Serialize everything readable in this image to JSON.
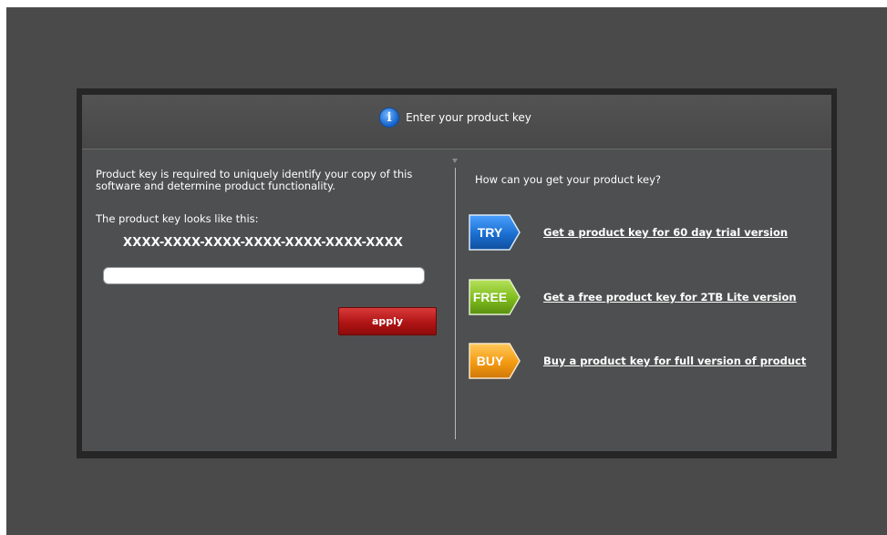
{
  "dialog": {
    "title": "Enter your product key",
    "info_icon": "info-icon"
  },
  "left": {
    "description": "Product key is required to uniquely identify your copy of this software and determine product functionality.",
    "key_label": "The product key looks like this:",
    "key_example": "XXXX-XXXX-XXXX-XXXX-XXXX-XXXX-XXXX",
    "input_value": "",
    "apply_label": "apply"
  },
  "right": {
    "question": "How can you get your product key?",
    "options": [
      {
        "badge": "TRY",
        "link": "Get a product key for 60 day trial version",
        "color": "#1b6fd0"
      },
      {
        "badge": "FREE",
        "link": "Get a free product key for 2TB Lite version",
        "color": "#7dbb1c"
      },
      {
        "badge": "BUY",
        "link": "Buy a product key for full version of product",
        "color": "#f39a12"
      }
    ]
  },
  "colors": {
    "background": "#4a4a4a",
    "dialog": "#4e4f50",
    "apply_red": "#b01414"
  }
}
